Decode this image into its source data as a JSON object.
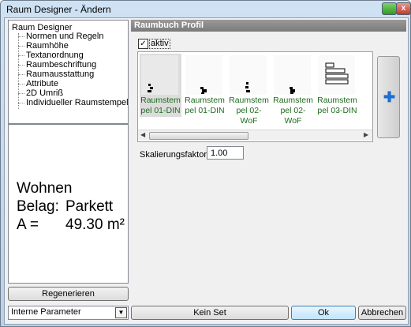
{
  "window": {
    "title": "Raum Designer - Ändern",
    "close_glyph": "x"
  },
  "tree": {
    "root": "Raum Designer",
    "items": [
      "Normen und Regeln",
      "Raumhöhe",
      "Textanordnung",
      "Raumbeschriftung",
      "Raumausstattung",
      "Attribute",
      "2D Umriß",
      "Individueller Raumstempel"
    ]
  },
  "preview": {
    "line1": "Wohnen",
    "belag_label": "Belag:",
    "belag_value": "Parkett",
    "area_label": "A =",
    "area_value": "49.30 m²"
  },
  "regenerate_label": "Regenerieren",
  "param_combo": {
    "value": "Interne Parameter"
  },
  "panel": {
    "header": "Raumbuch Profil",
    "aktiv_label": "aktiv",
    "aktiv_checked": true,
    "check_glyph": "✓"
  },
  "gallery": {
    "tiles": [
      {
        "line1": "Raumstem",
        "line2": "pel 01-DIN",
        "selected": true
      },
      {
        "line1": "Raumstem",
        "line2": "pel 01-DIN",
        "selected": false
      },
      {
        "line1": "Raumstem",
        "line2": "pel 02-WoF",
        "selected": false
      },
      {
        "line1": "Raumstem",
        "line2": "pel 02-WoF",
        "selected": false
      },
      {
        "line1": "Raumstem",
        "line2": "pel 03-DIN",
        "selected": false
      }
    ],
    "scroll_left": "◀",
    "scroll_right": "▶"
  },
  "add_button": {
    "icon": "plus-icon",
    "glyph": "✚",
    "color": "#1f6fd1"
  },
  "scale": {
    "label": "Skalierungsfaktor :",
    "value": "1.00"
  },
  "buttons": {
    "kein_set": "Kein Set",
    "ok": "Ok",
    "cancel": "Abbrechen"
  }
}
